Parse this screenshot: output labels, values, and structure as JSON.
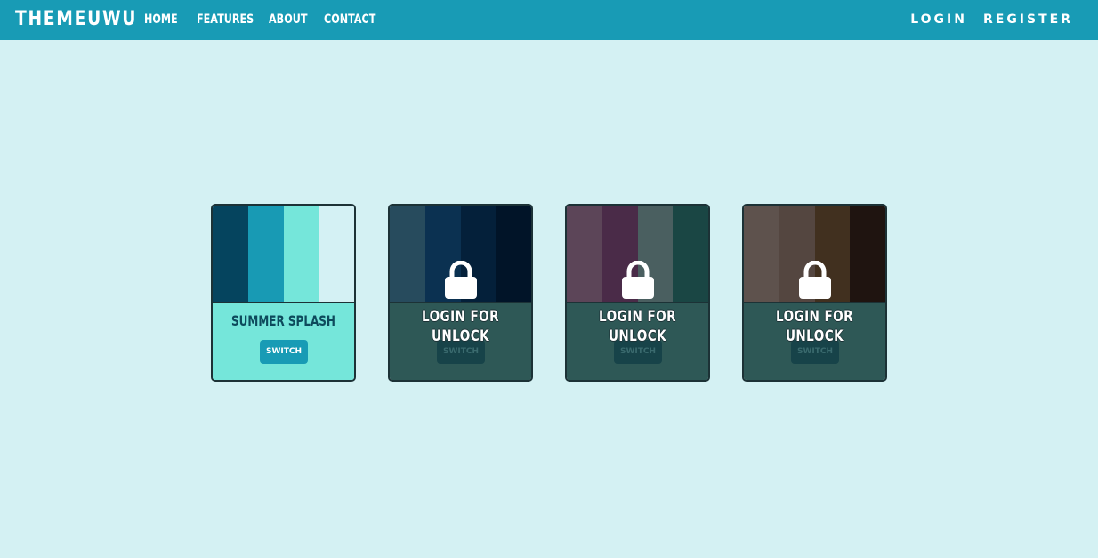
{
  "nav": {
    "brand": "THEMEUWU",
    "links": [
      "HOME",
      "FEATURES",
      "ABOUT",
      "CONTACT"
    ],
    "login": "LOGIN",
    "register": "REGISTER"
  },
  "colors": {
    "navbar": "#189bb5",
    "page_background": "#d4f1f3",
    "locked_body": "#2e5856"
  },
  "themes": [
    {
      "name": "SUMMER SPLASH",
      "swatches": [
        "#05445e",
        "#189ab4",
        "#75e6da",
        "#d4f1f4"
      ],
      "body_color": "#75e6da",
      "switch_label": "SWITCH",
      "locked": false
    },
    {
      "name": "",
      "swatches": [
        "#274b5d",
        "#0b3151",
        "#04203a",
        "#011428"
      ],
      "body_color": "#2e5856",
      "switch_label": "SWITCH",
      "locked": true,
      "lock_label": "LOGIN FOR UNLOCK",
      "lock_icon": "lock-icon"
    },
    {
      "name": "",
      "swatches": [
        "#5c4558",
        "#4a2b48",
        "#4a5f60",
        "#1a4644"
      ],
      "body_color": "#2e5856",
      "switch_label": "SWITCH",
      "locked": true,
      "lock_label": "LOGIN FOR UNLOCK",
      "lock_icon": "lock-icon"
    },
    {
      "name": "",
      "swatches": [
        "#5e524d",
        "#544640",
        "#41301f",
        "#1f1410"
      ],
      "body_color": "#2e5856",
      "switch_label": "SWITCH",
      "locked": true,
      "lock_label": "LOGIN FOR UNLOCK",
      "lock_icon": "lock-icon"
    }
  ]
}
